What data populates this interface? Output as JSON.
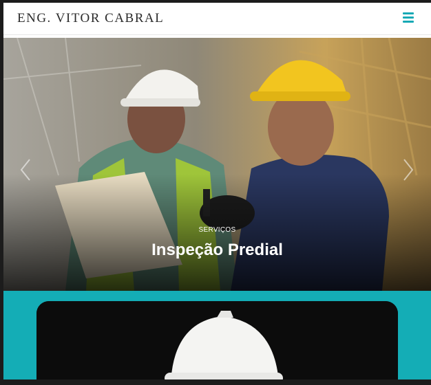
{
  "header": {
    "logo_text": "ENG. VITOR CABRAL",
    "menu_icon": "hamburger-menu-icon",
    "accent_color": "#17a9b5"
  },
  "slider": {
    "eyebrow": "SERVIÇOS",
    "title": "Inspeção Predial",
    "prev_icon": "chevron-left-icon",
    "next_icon": "chevron-right-icon"
  },
  "section": {
    "background_color": "#14adb6"
  }
}
